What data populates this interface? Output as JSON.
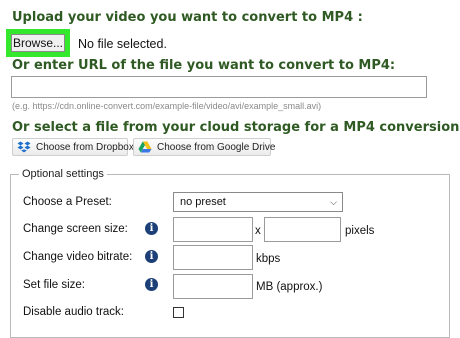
{
  "upload": {
    "heading": "Upload your video you want to convert to MP4 :",
    "browse_label": "Browse...",
    "file_status": "No file selected."
  },
  "url": {
    "heading": "Or enter URL of the file you want to convert to MP4:",
    "value": "",
    "hint": "(e.g. https://cdn.online-convert.com/example-file/video/avi/example_small.avi)"
  },
  "cloud": {
    "heading": "Or select a file from your cloud storage for a MP4 conversion:",
    "dropbox_label": "Choose from Dropbox",
    "gdrive_label": "Choose from Google Drive",
    "dropbox_icon": "dropbox-icon",
    "gdrive_icon": "google-drive-icon"
  },
  "settings": {
    "legend": "Optional settings",
    "preset_label": "Choose a Preset:",
    "preset_value": "no preset",
    "screen_size_label": "Change screen size:",
    "screen_size_x": "x",
    "screen_size_unit": "pixels",
    "bitrate_label": "Change video bitrate:",
    "bitrate_unit": "kbps",
    "file_size_label": "Set file size:",
    "file_size_unit": "MB (approx.)",
    "disable_audio_label": "Disable audio track:",
    "disable_audio_checked": false,
    "info_glyph": "i"
  },
  "colors": {
    "heading_green": "#2f5a23",
    "highlight_green": "#34e82e",
    "info_blue": "#1d3f78"
  }
}
